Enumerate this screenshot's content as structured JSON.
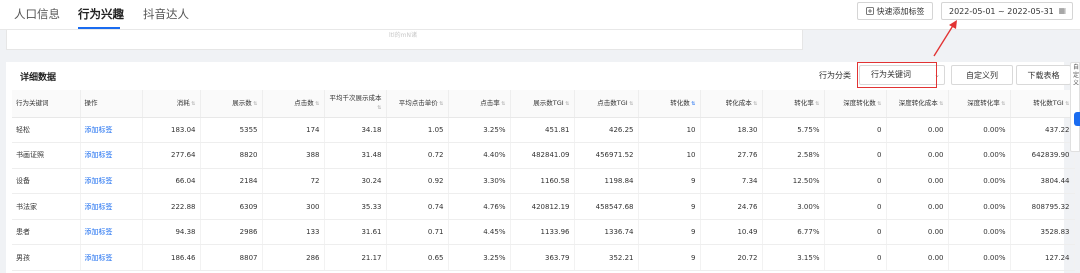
{
  "tabs": [
    {
      "label": "人口信息",
      "active": false
    },
    {
      "label": "行为兴趣",
      "active": true
    },
    {
      "label": "抖音达人",
      "active": false
    }
  ],
  "toolbar": {
    "quick_add_label": "快速添加标签",
    "date_range": "2022-05-01 ~ 2022-05-31"
  },
  "upper_card": {
    "faint_text": "ltl的mN诸"
  },
  "detail": {
    "title": "详细数据",
    "category_label": "行为分类",
    "category_value": "行为关键词",
    "custom_columns_label": "自定义列",
    "download_label": "下载表格"
  },
  "table": {
    "headers": [
      "行为关键词",
      "操作",
      "消耗",
      "展示数",
      "点击数",
      "平均千次展示成本",
      "平均点击单价",
      "点击率",
      "展示数TGI",
      "点击数TGI",
      "转化数",
      "转化成本",
      "转化率",
      "深度转化数",
      "深度转化成本",
      "深度转化率",
      "转化数TGI"
    ],
    "rows": [
      [
        "轻松",
        "添加标签",
        "183.04",
        "5355",
        "174",
        "34.18",
        "1.05",
        "3.25%",
        "451.81",
        "426.25",
        "10",
        "18.30",
        "5.75%",
        "0",
        "0.00",
        "0.00%",
        "437.22"
      ],
      [
        "书画证照",
        "添加标签",
        "277.64",
        "8820",
        "388",
        "31.48",
        "0.72",
        "4.40%",
        "482841.09",
        "456971.52",
        "10",
        "27.76",
        "2.58%",
        "0",
        "0.00",
        "0.00%",
        "642839.90"
      ],
      [
        "设备",
        "添加标签",
        "66.04",
        "2184",
        "72",
        "30.24",
        "0.92",
        "3.30%",
        "1160.58",
        "1198.84",
        "9",
        "7.34",
        "12.50%",
        "0",
        "0.00",
        "0.00%",
        "3804.44"
      ],
      [
        "书法家",
        "添加标签",
        "222.88",
        "6309",
        "300",
        "35.33",
        "0.74",
        "4.76%",
        "420812.19",
        "458547.68",
        "9",
        "24.76",
        "3.00%",
        "0",
        "0.00",
        "0.00%",
        "808795.32"
      ],
      [
        "患者",
        "添加标签",
        "94.38",
        "2986",
        "133",
        "31.61",
        "0.71",
        "4.45%",
        "1133.96",
        "1336.74",
        "9",
        "10.49",
        "6.77%",
        "0",
        "0.00",
        "0.00%",
        "3528.83"
      ],
      [
        "男孩",
        "添加标签",
        "186.46",
        "8807",
        "286",
        "21.17",
        "0.65",
        "3.25%",
        "363.79",
        "352.21",
        "9",
        "20.72",
        "3.15%",
        "0",
        "0.00",
        "0.00%",
        "127.24"
      ]
    ]
  },
  "side_panel": {
    "text": "自定义"
  },
  "colors": {
    "accent": "#1a6cf0",
    "highlight": "#e23333"
  },
  "icons": {
    "quick_add": "tag-icon",
    "date": "calendar-icon",
    "sort": "sort-icon"
  }
}
